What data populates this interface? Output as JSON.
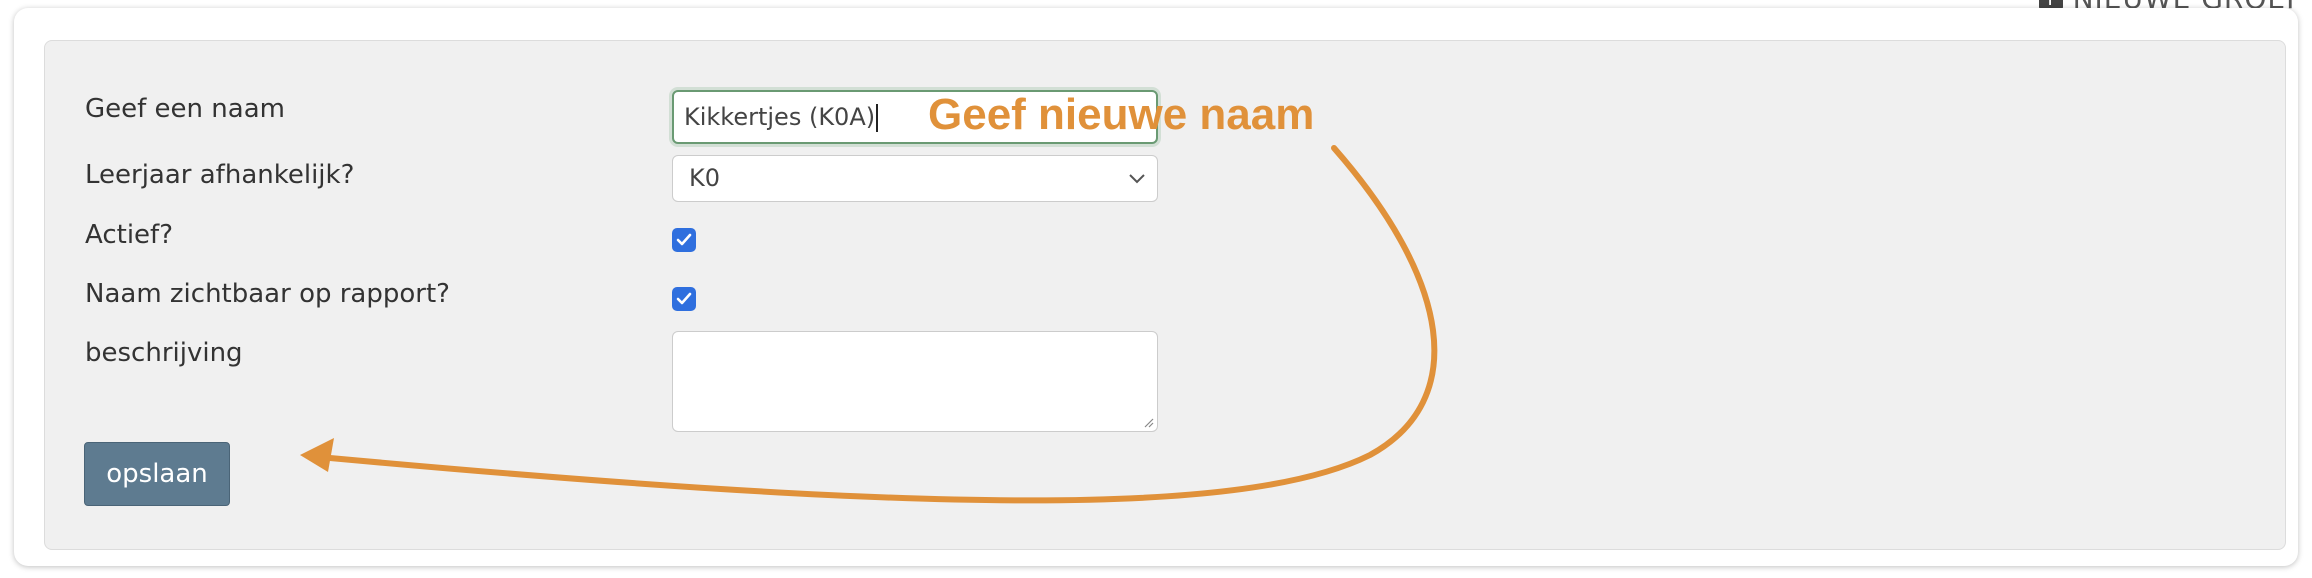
{
  "header": {
    "new_group_label": "NIEUWE GROEP"
  },
  "form": {
    "name_label": "Geef een naam",
    "name_value": "Kikkertjes (K0A)",
    "grade_label": "Leerjaar afhankelijk?",
    "grade_value": "K0",
    "active_label": "Actief?",
    "active_checked": true,
    "visible_label": "Naam zichtbaar op rapport?",
    "visible_checked": true,
    "description_label": "beschrijving",
    "description_value": "",
    "save_label": "opslaan"
  },
  "annotation": {
    "text": "Geef nieuwe naam",
    "color": "#e0913a"
  },
  "colors": {
    "button": "#5e7b90",
    "checkbox": "#2f6fde",
    "panel": "#f0f0f0"
  }
}
